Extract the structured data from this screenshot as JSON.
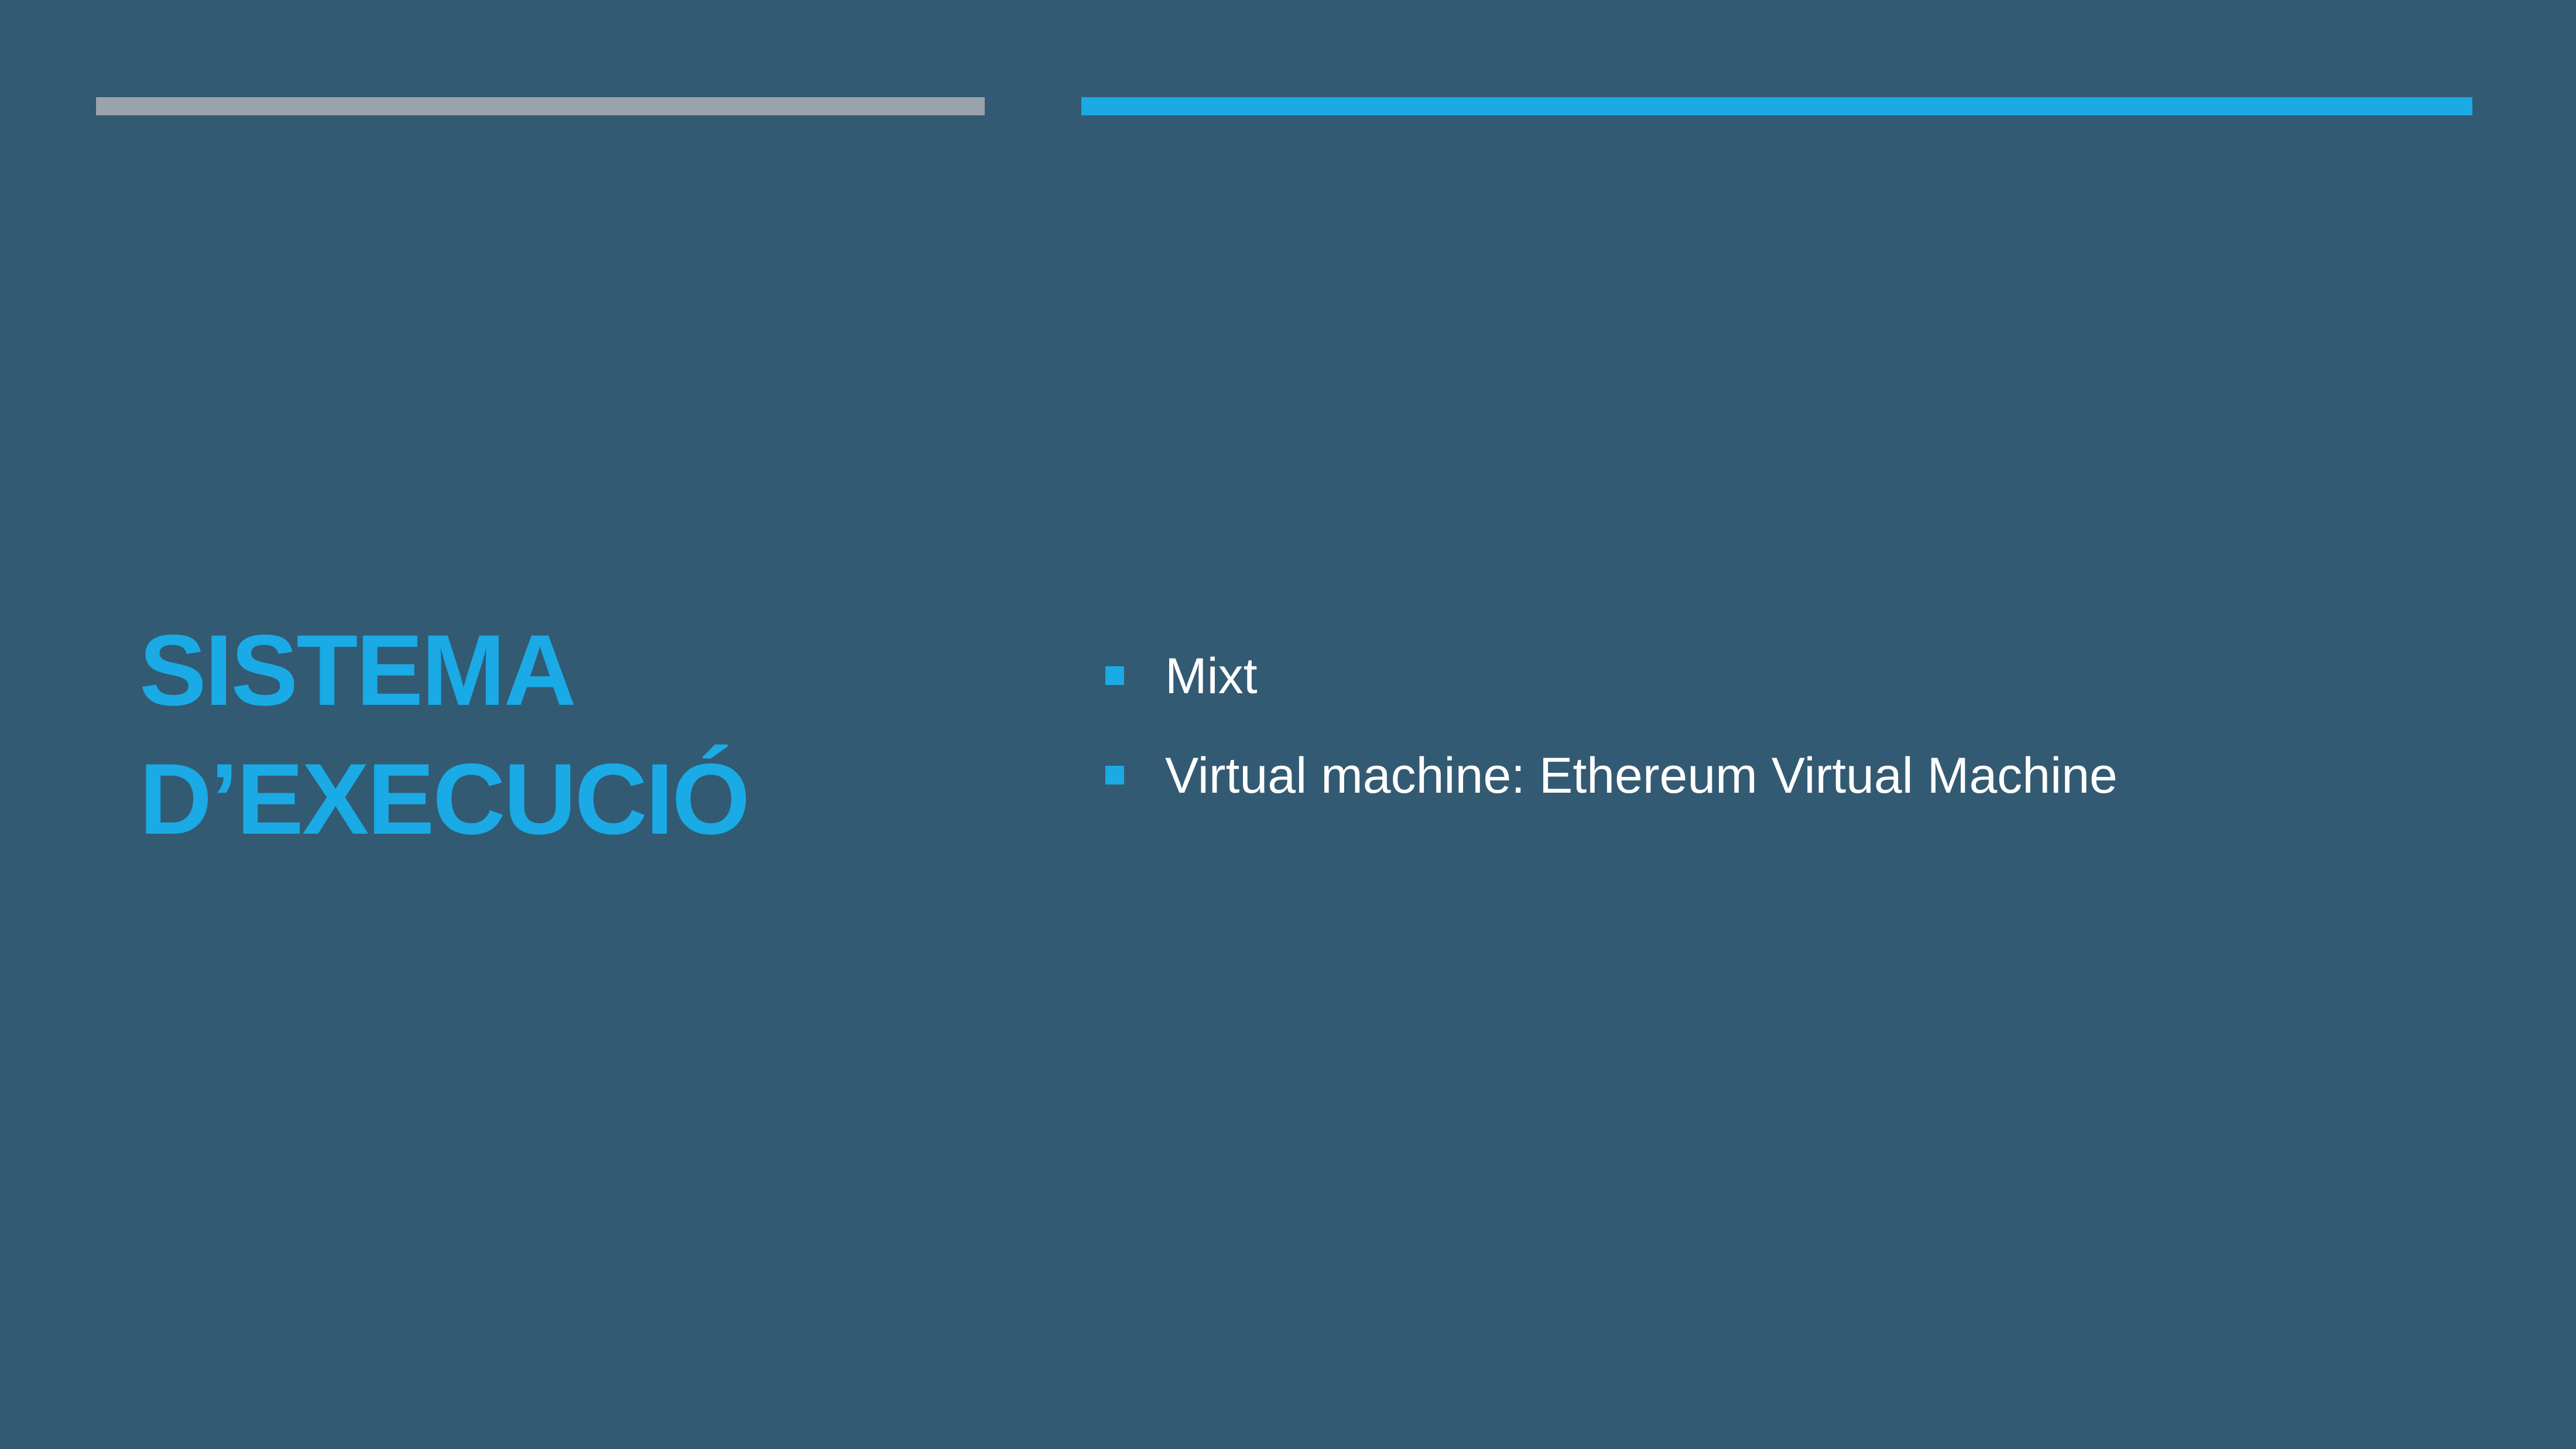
{
  "slide": {
    "title_line_1": "SISTEMA",
    "title_line_2": "D’EXECUCIÓ",
    "bullets": [
      {
        "text": "Mixt"
      },
      {
        "text": "Virtual machine: Ethereum Virtual Machine"
      }
    ]
  },
  "colors": {
    "background": "#335a73",
    "accent": "#1aaae5",
    "bar_gray": "#9aa2ab",
    "text": "#ffffff"
  }
}
